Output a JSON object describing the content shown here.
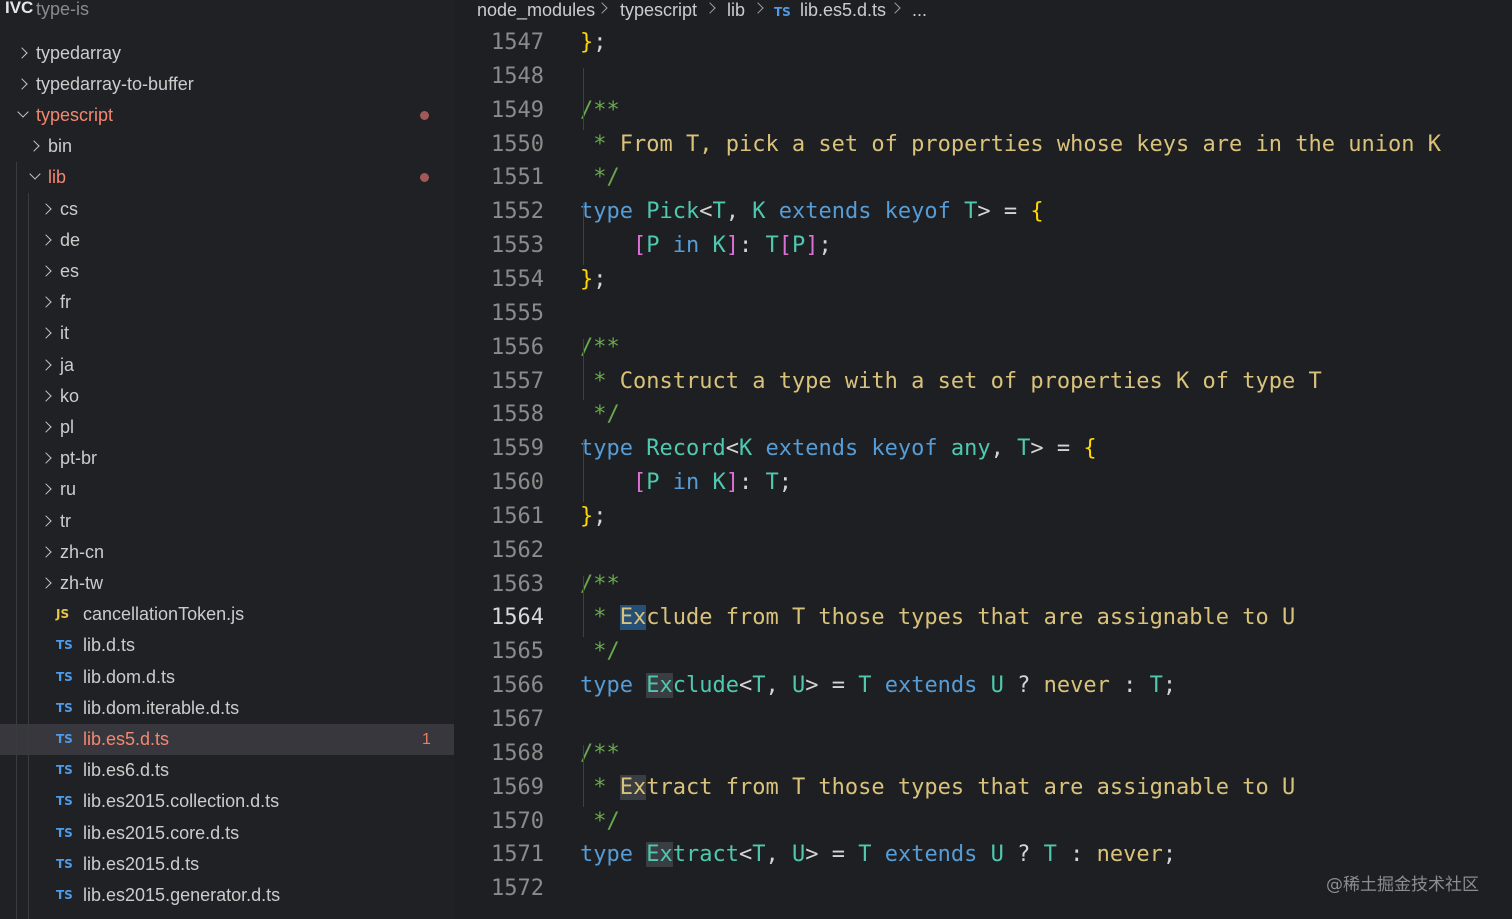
{
  "app_title": "IVC",
  "sidebar": {
    "cut_row": "type-is",
    "rows": [
      {
        "label": "typedarray",
        "kind": "folder",
        "open": false,
        "depth": 0
      },
      {
        "label": "typedarray-to-buffer",
        "kind": "folder",
        "open": false,
        "depth": 0
      },
      {
        "label": "typescript",
        "kind": "folder",
        "open": true,
        "depth": 0,
        "modified": true,
        "dot": true
      },
      {
        "label": "bin",
        "kind": "folder",
        "open": false,
        "depth": 1
      },
      {
        "label": "lib",
        "kind": "folder",
        "open": true,
        "depth": 1,
        "modified": true,
        "dot": true
      },
      {
        "label": "cs",
        "kind": "folder",
        "open": false,
        "depth": 2
      },
      {
        "label": "de",
        "kind": "folder",
        "open": false,
        "depth": 2
      },
      {
        "label": "es",
        "kind": "folder",
        "open": false,
        "depth": 2
      },
      {
        "label": "fr",
        "kind": "folder",
        "open": false,
        "depth": 2
      },
      {
        "label": "it",
        "kind": "folder",
        "open": false,
        "depth": 2
      },
      {
        "label": "ja",
        "kind": "folder",
        "open": false,
        "depth": 2
      },
      {
        "label": "ko",
        "kind": "folder",
        "open": false,
        "depth": 2
      },
      {
        "label": "pl",
        "kind": "folder",
        "open": false,
        "depth": 2
      },
      {
        "label": "pt-br",
        "kind": "folder",
        "open": false,
        "depth": 2
      },
      {
        "label": "ru",
        "kind": "folder",
        "open": false,
        "depth": 2
      },
      {
        "label": "tr",
        "kind": "folder",
        "open": false,
        "depth": 2
      },
      {
        "label": "zh-cn",
        "kind": "folder",
        "open": false,
        "depth": 2
      },
      {
        "label": "zh-tw",
        "kind": "folder",
        "open": false,
        "depth": 2
      },
      {
        "label": "cancellationToken.js",
        "kind": "js",
        "depth": 2
      },
      {
        "label": "lib.d.ts",
        "kind": "ts",
        "depth": 2
      },
      {
        "label": "lib.dom.d.ts",
        "kind": "ts",
        "depth": 2
      },
      {
        "label": "lib.dom.iterable.d.ts",
        "kind": "ts",
        "depth": 2
      },
      {
        "label": "lib.es5.d.ts",
        "kind": "ts",
        "depth": 2,
        "selected": true,
        "modified": true,
        "badge": "1"
      },
      {
        "label": "lib.es6.d.ts",
        "kind": "ts",
        "depth": 2
      },
      {
        "label": "lib.es2015.collection.d.ts",
        "kind": "ts",
        "depth": 2
      },
      {
        "label": "lib.es2015.core.d.ts",
        "kind": "ts",
        "depth": 2
      },
      {
        "label": "lib.es2015.d.ts",
        "kind": "ts",
        "depth": 2
      },
      {
        "label": "lib.es2015.generator.d.ts",
        "kind": "ts",
        "depth": 2
      }
    ],
    "icons": {
      "ts": "TS",
      "js": "JS"
    }
  },
  "breadcrumb": {
    "items": [
      "node_modules",
      "typescript",
      "lib",
      "lib.es5.d.ts",
      "..."
    ],
    "file_icon": "TS"
  },
  "editor": {
    "active_line": 1564,
    "lines": [
      {
        "n": "1547",
        "tokens": [
          [
            "br",
            "}"
          ],
          [
            "plain",
            ";"
          ]
        ]
      },
      {
        "n": "1548",
        "tokens": []
      },
      {
        "n": "1549",
        "tokens": [
          [
            "cmt",
            "/**"
          ]
        ]
      },
      {
        "n": "1550",
        "tokens": [
          [
            "cmt",
            " * "
          ],
          [
            "cmt2",
            "From T, pick a set of properties whose keys are in the union K"
          ]
        ]
      },
      {
        "n": "1551",
        "tokens": [
          [
            "cmt",
            " */"
          ]
        ]
      },
      {
        "n": "1552",
        "tokens": [
          [
            "kw",
            "type "
          ],
          [
            "tp",
            "Pick"
          ],
          [
            "plain",
            "<"
          ],
          [
            "tp",
            "T"
          ],
          [
            "plain",
            ", "
          ],
          [
            "tp",
            "K "
          ],
          [
            "kw",
            "extends keyof "
          ],
          [
            "tp",
            "T"
          ],
          [
            "plain",
            "> = "
          ],
          [
            "br",
            "{"
          ]
        ]
      },
      {
        "n": "1553",
        "tokens": [
          [
            "plain",
            "    "
          ],
          [
            "br2",
            "["
          ],
          [
            "tp",
            "P "
          ],
          [
            "kw",
            "in "
          ],
          [
            "tp",
            "K"
          ],
          [
            "br2",
            "]"
          ],
          [
            "plain",
            ": "
          ],
          [
            "tp",
            "T"
          ],
          [
            "br2",
            "["
          ],
          [
            "tp",
            "P"
          ],
          [
            "br2",
            "]"
          ],
          [
            "plain",
            ";"
          ]
        ]
      },
      {
        "n": "1554",
        "tokens": [
          [
            "br",
            "}"
          ],
          [
            "plain",
            ";"
          ]
        ]
      },
      {
        "n": "1555",
        "tokens": []
      },
      {
        "n": "1556",
        "tokens": [
          [
            "cmt",
            "/**"
          ]
        ]
      },
      {
        "n": "1557",
        "tokens": [
          [
            "cmt",
            " * "
          ],
          [
            "cmt2",
            "Construct a type with a set of properties K of type T"
          ]
        ]
      },
      {
        "n": "1558",
        "tokens": [
          [
            "cmt",
            " */"
          ]
        ]
      },
      {
        "n": "1559",
        "tokens": [
          [
            "kw",
            "type "
          ],
          [
            "tp",
            "Record"
          ],
          [
            "plain",
            "<"
          ],
          [
            "tp",
            "K "
          ],
          [
            "kw",
            "extends keyof "
          ],
          [
            "tp",
            "any"
          ],
          [
            "plain",
            ", "
          ],
          [
            "tp",
            "T"
          ],
          [
            "plain",
            "> = "
          ],
          [
            "br",
            "{"
          ]
        ]
      },
      {
        "n": "1560",
        "tokens": [
          [
            "plain",
            "    "
          ],
          [
            "br2",
            "["
          ],
          [
            "tp",
            "P "
          ],
          [
            "kw",
            "in "
          ],
          [
            "tp",
            "K"
          ],
          [
            "br2",
            "]"
          ],
          [
            "plain",
            ": "
          ],
          [
            "tp",
            "T"
          ],
          [
            "plain",
            ";"
          ]
        ]
      },
      {
        "n": "1561",
        "tokens": [
          [
            "br",
            "}"
          ],
          [
            "plain",
            ";"
          ]
        ]
      },
      {
        "n": "1562",
        "tokens": []
      },
      {
        "n": "1563",
        "tokens": [
          [
            "cmt",
            "/**"
          ]
        ]
      },
      {
        "n": "1564",
        "tokens": [
          [
            "cmt",
            " * "
          ],
          [
            "cmt2 hl-cur",
            "Ex"
          ],
          [
            "cmt2",
            "clude from T those types that are assignable to U"
          ]
        ]
      },
      {
        "n": "1565",
        "tokens": [
          [
            "cmt",
            " */"
          ]
        ]
      },
      {
        "n": "1566",
        "tokens": [
          [
            "kw",
            "type "
          ],
          [
            "tp hl-word",
            "Ex"
          ],
          [
            "tp",
            "clude"
          ],
          [
            "plain",
            "<"
          ],
          [
            "tp",
            "T"
          ],
          [
            "plain",
            ", "
          ],
          [
            "tp",
            "U"
          ],
          [
            "plain",
            "> = "
          ],
          [
            "tp",
            "T "
          ],
          [
            "kw",
            "extends "
          ],
          [
            "tp",
            "U "
          ],
          [
            "plain",
            "? "
          ],
          [
            "cmt2",
            "never"
          ],
          [
            "plain",
            " : "
          ],
          [
            "tp",
            "T"
          ],
          [
            "plain",
            ";"
          ]
        ]
      },
      {
        "n": "1567",
        "tokens": []
      },
      {
        "n": "1568",
        "tokens": [
          [
            "cmt",
            "/**"
          ]
        ]
      },
      {
        "n": "1569",
        "tokens": [
          [
            "cmt",
            " * "
          ],
          [
            "cmt2 hl-word",
            "Ex"
          ],
          [
            "cmt2",
            "tract from T those types that are assignable to U"
          ]
        ]
      },
      {
        "n": "1570",
        "tokens": [
          [
            "cmt",
            " */"
          ]
        ]
      },
      {
        "n": "1571",
        "tokens": [
          [
            "kw",
            "type "
          ],
          [
            "tp hl-word",
            "Ex"
          ],
          [
            "tp",
            "tract"
          ],
          [
            "plain",
            "<"
          ],
          [
            "tp",
            "T"
          ],
          [
            "plain",
            ", "
          ],
          [
            "tp",
            "U"
          ],
          [
            "plain",
            "> = "
          ],
          [
            "tp",
            "T "
          ],
          [
            "kw",
            "extends "
          ],
          [
            "tp",
            "U "
          ],
          [
            "plain",
            "? "
          ],
          [
            "tp",
            "T"
          ],
          [
            "plain",
            " : "
          ],
          [
            "cmt2",
            "never"
          ],
          [
            "plain",
            ";"
          ]
        ]
      },
      {
        "n": "1572",
        "tokens": []
      }
    ]
  },
  "watermark": "@稀土掘金技术社区"
}
